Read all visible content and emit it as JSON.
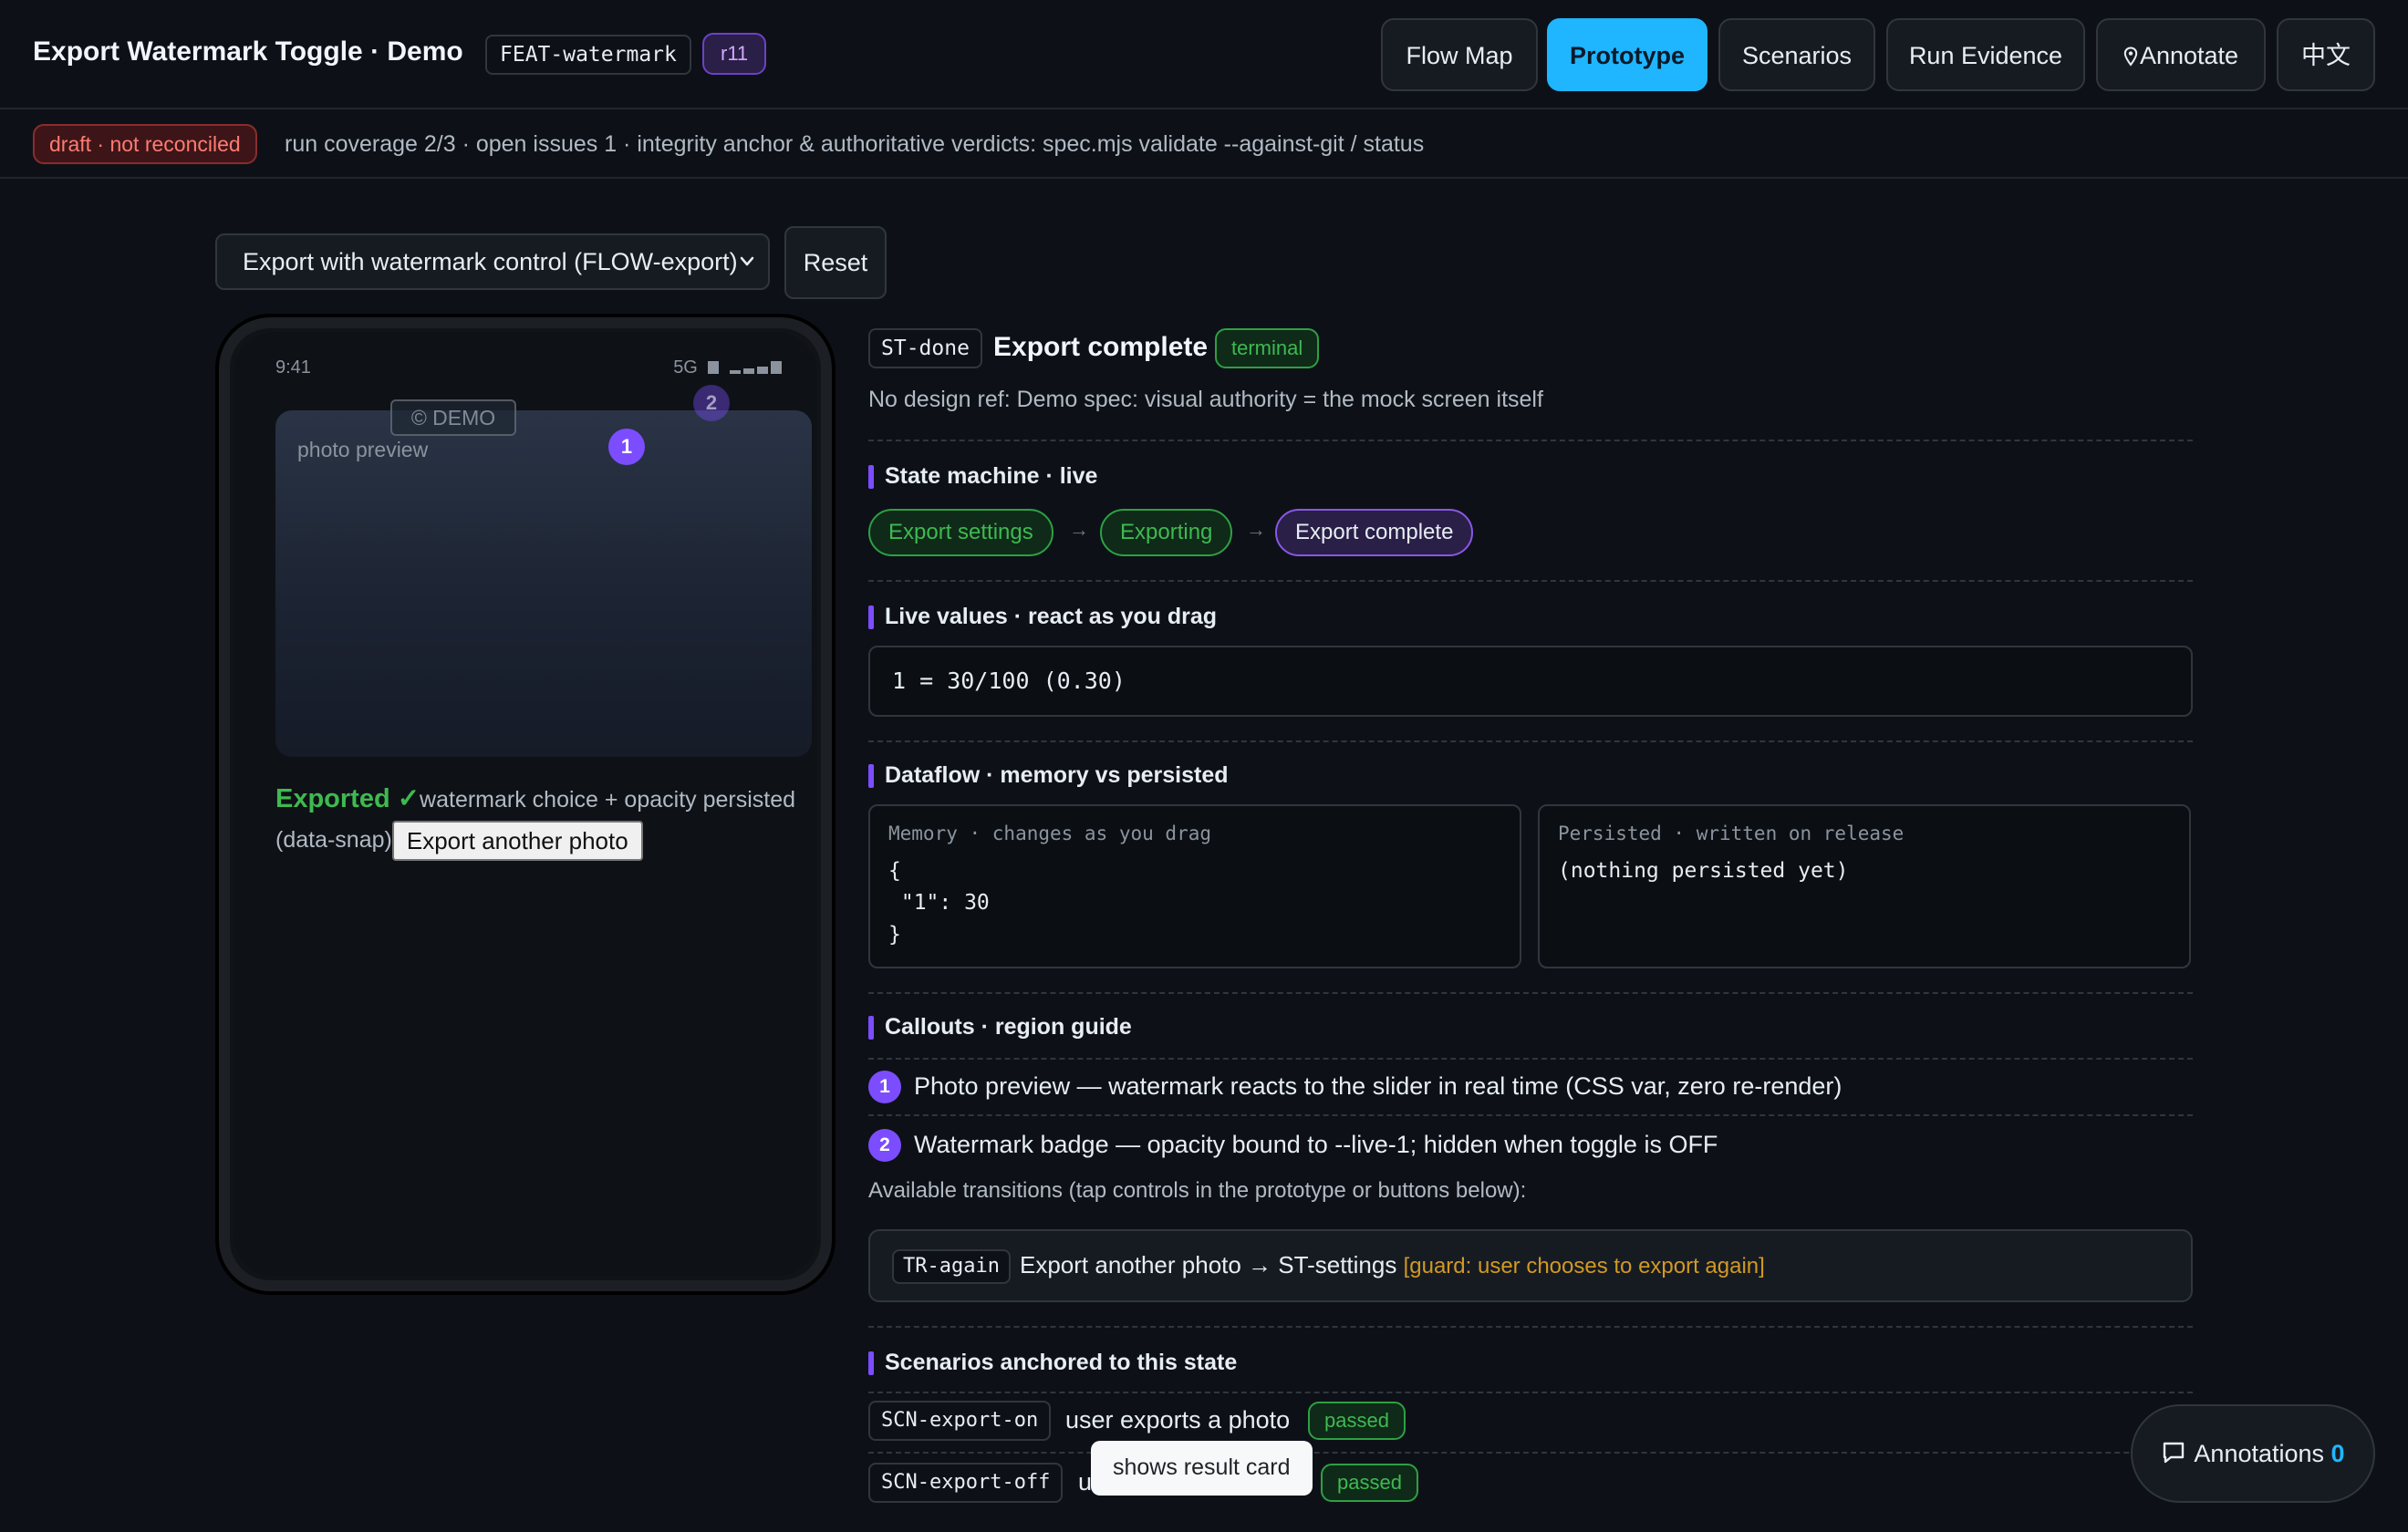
{
  "header": {
    "title": "Export Watermark Toggle · Demo",
    "feature_tag": "FEAT-watermark",
    "revision": "r11",
    "nav": [
      "Flow Map",
      "Prototype",
      "Scenarios",
      "Run Evidence",
      "Annotate",
      "中文"
    ],
    "active_nav": "Prototype"
  },
  "subbar": {
    "draft_badge": "draft · not reconciled",
    "text": "run coverage 2/3 · open issues 1 · integrity anchor & authoritative verdicts: spec.mjs validate --against-git / status"
  },
  "controls": {
    "flow_select": "Export with watermark control (FLOW-export)",
    "reset": "Reset"
  },
  "phone": {
    "time": "9:41",
    "network": "5G",
    "photo_label": "photo preview",
    "watermark": "© DEMO",
    "callout_1": "1",
    "callout_2": "2",
    "exported": "Exported ✓",
    "exported_note": "watermark choice + opacity persisted (data-snap)",
    "again_button": "Export another photo"
  },
  "state": {
    "id": "ST-done",
    "title": "Export complete",
    "badge": "terminal",
    "design_note": "No design ref: Demo spec: visual authority = the mock screen itself"
  },
  "state_machine": {
    "heading": "State machine · live",
    "states": [
      "Export settings",
      "Exporting",
      "Export complete"
    ],
    "current": "Export complete"
  },
  "live_values": {
    "heading": "Live values · react as you drag",
    "value": "1 = 30/100 (0.30)"
  },
  "dataflow": {
    "heading": "Dataflow · memory vs persisted",
    "memory_label": "Memory · changes as you drag",
    "memory_body": "{\n \"1\": 30\n}",
    "persisted_label": "Persisted · written on release",
    "persisted_body": "(nothing persisted yet)"
  },
  "callouts": {
    "heading": "Callouts · region guide",
    "items": [
      {
        "num": "1",
        "text": "Photo preview — watermark reacts to the slider in real time (CSS var, zero re-render)"
      },
      {
        "num": "2",
        "text": "Watermark badge — opacity bound to --live-1; hidden when toggle is OFF"
      }
    ]
  },
  "transitions": {
    "label": "Available transitions (tap controls in the prototype or buttons below):",
    "items": [
      {
        "id": "TR-again",
        "text": "Export another photo → ST-settings",
        "guard": "[guard: user chooses to export again]"
      }
    ]
  },
  "scenarios": {
    "heading": "Scenarios anchored to this state",
    "items": [
      {
        "id": "SCN-export-on",
        "text": "user exports a photo",
        "status": "passed"
      },
      {
        "id": "SCN-export-off",
        "text": "u",
        "status": "passed"
      }
    ]
  },
  "tooltip": "shows result card",
  "annotations": {
    "label": "Annotations",
    "count": "0"
  }
}
